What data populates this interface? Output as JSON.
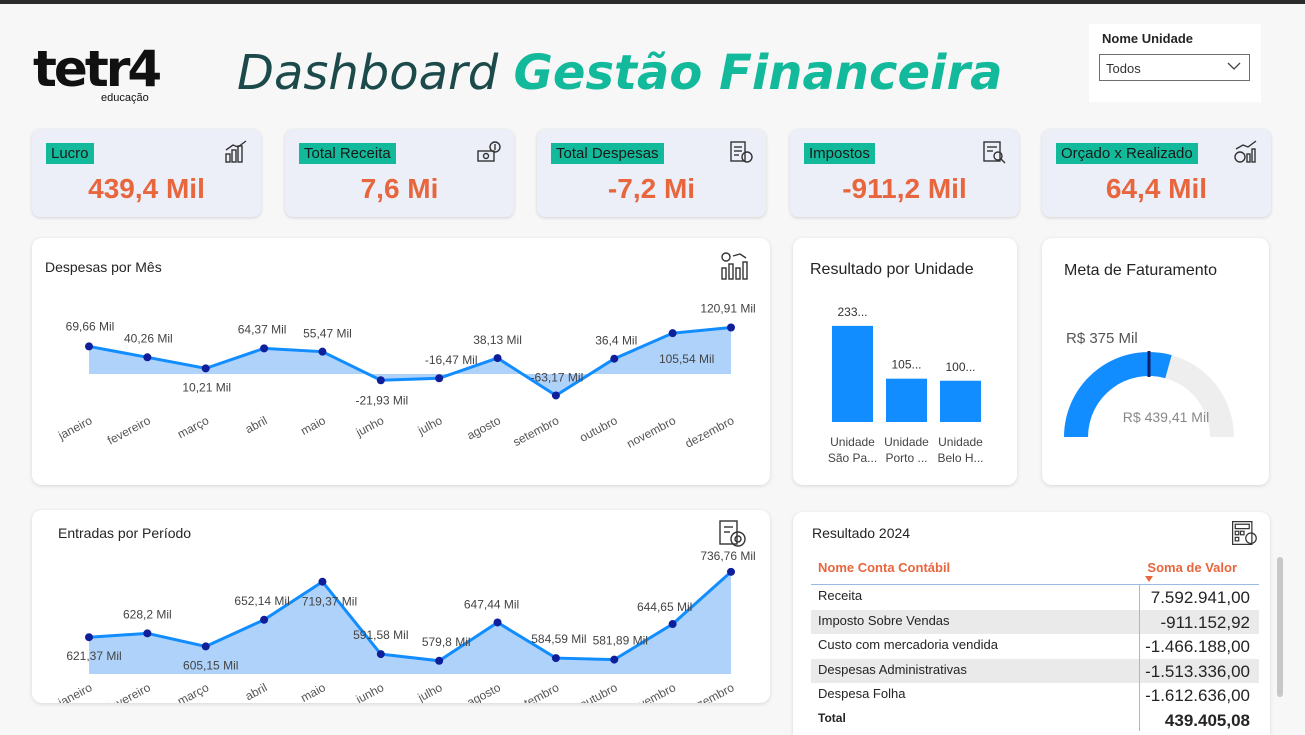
{
  "brand": {
    "logo_word": "tetr4",
    "logo_sub": "educação"
  },
  "header": {
    "title_part1": "Dashboard ",
    "title_part2": "Gestão Financeira"
  },
  "slicer": {
    "label": "Nome Unidade",
    "selected": "Todos"
  },
  "kpis": [
    {
      "label": "Lucro",
      "value": "439,4 Mil",
      "icon": "bar-chart-icon"
    },
    {
      "label": "Total Receita",
      "value": "7,6 Mi",
      "icon": "money-icon"
    },
    {
      "label": "Total Despesas",
      "value": "-7,2 Mi",
      "icon": "invoice-icon"
    },
    {
      "label": "Impostos",
      "value": "-911,2 Mil",
      "icon": "tax-icon"
    },
    {
      "label": "Orçado x Realizado",
      "value": "64,4 Mil",
      "icon": "growth-icon"
    }
  ],
  "colors": {
    "accent": "#12b99a",
    "kpi_value": "#e8663d",
    "series": "#118dff",
    "area": "#a5cdf8"
  },
  "despesas_chart": {
    "title": "Despesas por Mês",
    "chart_data": {
      "type": "area",
      "categories": [
        "janeiro",
        "fevereiro",
        "março",
        "abril",
        "maio",
        "junho",
        "julho",
        "agosto",
        "setembro",
        "outubro",
        "novembro",
        "dezembro"
      ],
      "values": [
        69.66,
        40.26,
        10.21,
        64.37,
        55.47,
        -21.93,
        -16.47,
        38.13,
        -63.17,
        36.4,
        105.54,
        120.91
      ],
      "labels": [
        "69,66 Mil",
        "40,26 Mil",
        "10,21 Mil",
        "64,37 Mil",
        "55,47 Mil",
        "-21,93 Mil",
        "-16,47 Mil",
        "38,13 Mil",
        "-63,17 Mil",
        "36,4 Mil",
        "105,54 Mil",
        "120,91 Mil"
      ],
      "ylim": [
        -70,
        125
      ]
    }
  },
  "entradas_chart": {
    "title": "Entradas por Período",
    "chart_data": {
      "type": "area",
      "categories": [
        "janeiro",
        "fevereiro",
        "março",
        "abril",
        "maio",
        "junho",
        "julho",
        "agosto",
        "setembro",
        "outubro",
        "novembro",
        "dezembro"
      ],
      "values": [
        621.37,
        628.2,
        605.15,
        652.14,
        719.37,
        591.58,
        579.8,
        647.44,
        584.59,
        581.89,
        644.65,
        736.76
      ],
      "labels": [
        "621,37 Mil",
        "628,2 Mil",
        "605,15 Mil",
        "652,14 Mil",
        "719,37 Mil",
        "591,58 Mil",
        "579,8 Mil",
        "647,44 Mil",
        "584,59 Mil",
        "581,89 Mil",
        "644,65 Mil",
        "736,76 Mil"
      ],
      "ylim": [
        560,
        740
      ]
    }
  },
  "unidade_chart": {
    "title": "Resultado por Unidade",
    "chart_data": {
      "type": "bar",
      "categories": [
        "Unidade São Pa...",
        "Unidade Porto ...",
        "Unidade Belo H..."
      ],
      "category_lines": [
        [
          "Unidade",
          "São Pa..."
        ],
        [
          "Unidade",
          "Porto ..."
        ],
        [
          "Unidade",
          "Belo H..."
        ]
      ],
      "values": [
        233,
        105,
        100
      ],
      "labels": [
        "233...",
        "105...",
        "100..."
      ],
      "ylim": [
        0,
        240
      ]
    }
  },
  "meta_chart": {
    "title": "Meta de Faturamento",
    "chart_data": {
      "type": "gauge",
      "target": 375,
      "value": 439.41,
      "max": 750,
      "target_label": "R$ 375 Mil",
      "value_label": "R$ 439,41 Mil"
    }
  },
  "resultado_table": {
    "title": "Resultado 2024",
    "headers": [
      "Nome Conta Contábil",
      "Soma de Valor"
    ],
    "rows": [
      [
        "Receita",
        "7.592.941,00"
      ],
      [
        "Imposto Sobre Vendas",
        "-911.152,92"
      ],
      [
        "Custo com mercadoria vendida",
        "-1.466.188,00"
      ],
      [
        "Despesas Administrativas",
        "-1.513.336,00"
      ],
      [
        "Despesa Folha",
        "-1.612.636,00"
      ]
    ],
    "total": [
      "Total",
      "439.405,08"
    ]
  }
}
